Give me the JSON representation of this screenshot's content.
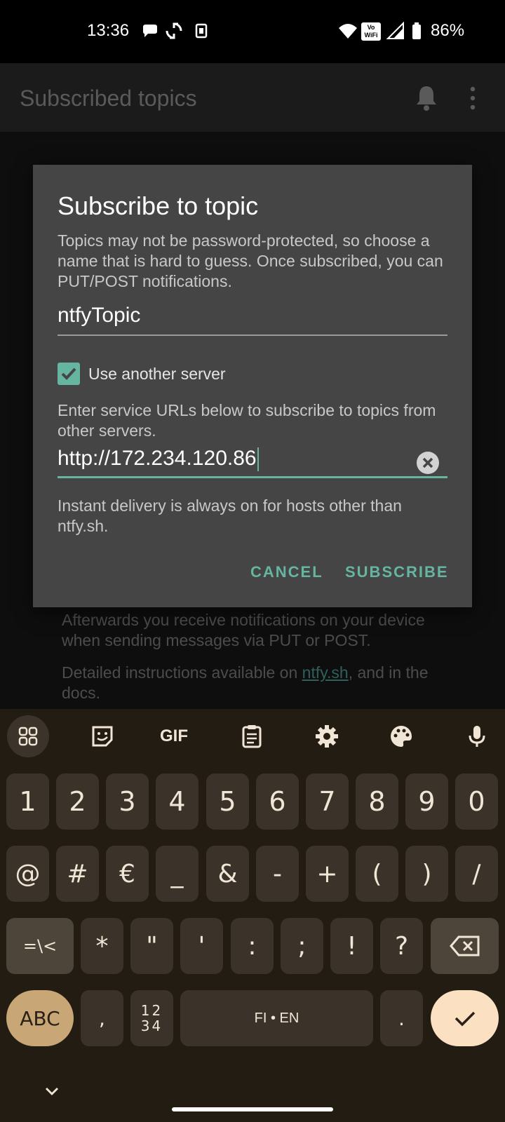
{
  "status_bar": {
    "time": "13:36",
    "battery": "86%",
    "icons": [
      "chat-bubble-icon",
      "sync-icon",
      "sim-card-icon",
      "wifi-icon",
      "vowifi-icon",
      "signal-icon",
      "battery-icon"
    ],
    "vowifi_text_1": "Vo",
    "vowifi_text_2": "WiFi"
  },
  "app_bar": {
    "title": "Subscribed topics",
    "icons": [
      "bell-icon",
      "more-vert-icon"
    ]
  },
  "background": {
    "line1": "Afterwards you receive notifications on your device when sending messages via PUT or POST.",
    "line2_prefix": "Detailed instructions available on ",
    "line2_link": "ntfy.sh",
    "line2_suffix": ", and in the docs."
  },
  "dialog": {
    "title": "Subscribe to topic",
    "description": "Topics may not be password-protected, so choose a name that is hard to guess. Once subscribed, you can PUT/POST notifications.",
    "topic_value": "ntfyTopic",
    "checkbox_label": "Use another server",
    "checkbox_checked": true,
    "server_hint": "Enter service URLs below to subscribe to topics from other servers.",
    "server_url_value": "http://172.234.120.86",
    "instant_note": "Instant delivery is always on for hosts other than ntfy.sh.",
    "cancel_label": "CANCEL",
    "subscribe_label": "SUBSCRIBE",
    "accent_color": "#65b5a0"
  },
  "keyboard": {
    "toolbar": [
      "apps-grid-icon",
      "sticker-icon",
      "gif-icon",
      "clipboard-icon",
      "settings-gear-icon",
      "palette-icon",
      "microphone-icon"
    ],
    "gif_label": "GIF",
    "row1": [
      "1",
      "2",
      "3",
      "4",
      "5",
      "6",
      "7",
      "8",
      "9",
      "0"
    ],
    "row2": [
      "@",
      "#",
      "€",
      "_",
      "&",
      "-",
      "+",
      "(",
      ")",
      "/"
    ],
    "row3_toggle": "=\\<",
    "row3": [
      "*",
      "\"",
      "'",
      ":",
      ";",
      "!",
      "?"
    ],
    "abc": "ABC",
    "comma": ",",
    "numpad_top": "12",
    "numpad_bottom": "34",
    "space": "FI • EN",
    "period": ".",
    "colors": {
      "background": "#231c13",
      "key": "#3b332a",
      "abc": "#c9a676",
      "enter": "#fbe0c2"
    }
  }
}
